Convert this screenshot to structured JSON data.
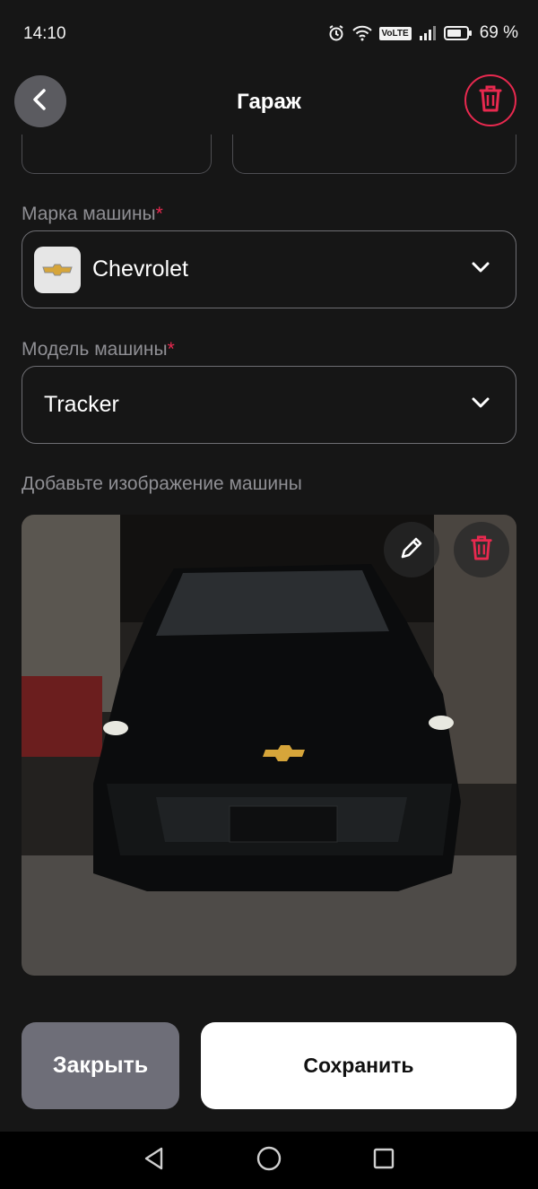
{
  "status_bar": {
    "time": "14:10",
    "battery": "69 %",
    "network_badge": "VoLTE"
  },
  "header": {
    "title": "Гараж",
    "back_icon": "chevron-left-icon",
    "delete_icon": "trash-icon"
  },
  "brand": {
    "label": "Марка машины",
    "required_mark": "*",
    "value": "Chevrolet",
    "logo_icon": "chevrolet-logo"
  },
  "model": {
    "label": "Модель машины",
    "required_mark": "*",
    "value": "Tracker"
  },
  "photo": {
    "label": "Добавьте изображение машины",
    "edit_icon": "pencil-icon",
    "delete_icon": "trash-icon"
  },
  "actions": {
    "close_label": "Закрыть",
    "save_label": "Сохранить"
  },
  "colors": {
    "accent": "#e8294f",
    "background": "#161616",
    "close_bg": "#6e6e78",
    "save_bg": "#ffffff"
  }
}
